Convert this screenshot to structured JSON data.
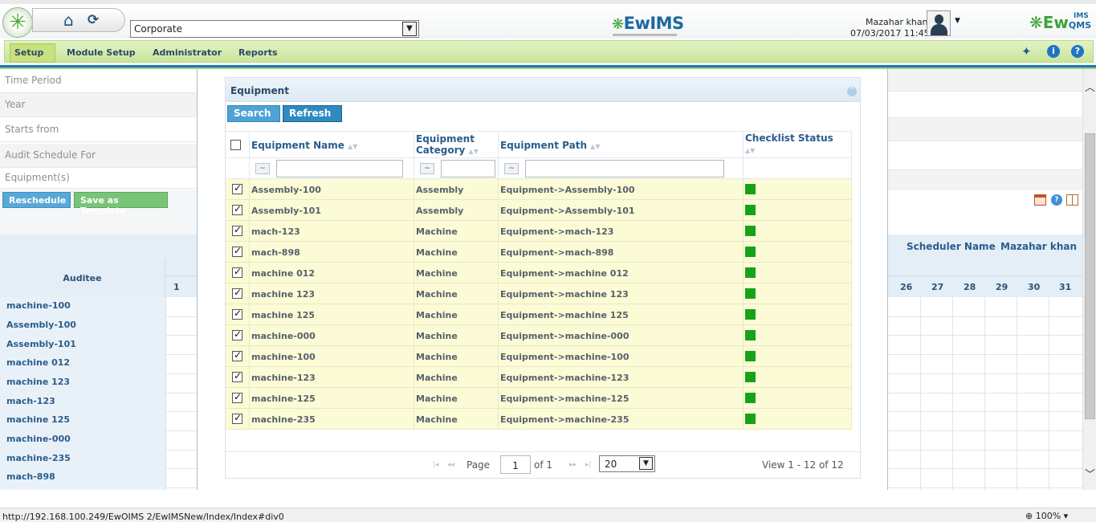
{
  "header": {
    "organization": "Corporate",
    "brand_center": "EwIMS",
    "user_name": "Mazahar khan",
    "user_datetime": "07/03/2017 11:45",
    "brand_right": "Ew",
    "brand_right_sup": "IMS",
    "brand_right_sub": "QMS"
  },
  "menu": {
    "items": [
      "Setup",
      "Module Setup",
      "Administrator",
      "Reports"
    ]
  },
  "form": {
    "rows": [
      "Time Period",
      "Year",
      "Starts from",
      "Audit Schedule For",
      "Equipment(s)"
    ]
  },
  "actions": {
    "reschedule": "Reschedule",
    "save_template": "Save as Template"
  },
  "calendar": {
    "auditee_header": "Auditee",
    "first_day": "1",
    "auditees": [
      "machine-100",
      "Assembly-100",
      "Assembly-101",
      "machine 012",
      "machine 123",
      "mach-123",
      "machine 125",
      "machine-000",
      "machine-235",
      "mach-898"
    ],
    "scheduler_label": "Scheduler Name",
    "scheduler_value": "Mazahar khan",
    "right_days": [
      "26",
      "27",
      "28",
      "29",
      "30",
      "31"
    ]
  },
  "dialog": {
    "title": "Equipment",
    "search_label": "Search",
    "refresh_label": "Refresh",
    "columns": {
      "name": "Equipment Name",
      "category_line1": "Equipment",
      "category_line2": "Category",
      "path": "Equipment Path",
      "checklist_line1": "Checklist Status",
      "checklist_line2": ""
    },
    "filter_icon": "~",
    "rows": [
      {
        "name": "Assembly-100",
        "category": "Assembly",
        "path": "Equipment->Assembly-100",
        "checked": true
      },
      {
        "name": "Assembly-101",
        "category": "Assembly",
        "path": "Equipment->Assembly-101",
        "checked": true
      },
      {
        "name": "mach-123",
        "category": "Machine",
        "path": "Equipment->mach-123",
        "checked": true
      },
      {
        "name": "mach-898",
        "category": "Machine",
        "path": "Equipment->mach-898",
        "checked": true
      },
      {
        "name": "machine 012",
        "category": "Machine",
        "path": "Equipment->machine 012",
        "checked": true
      },
      {
        "name": "machine 123",
        "category": "Machine",
        "path": "Equipment->machine 123",
        "checked": true
      },
      {
        "name": "machine 125",
        "category": "Machine",
        "path": "Equipment->machine 125",
        "checked": true
      },
      {
        "name": "machine-000",
        "category": "Machine",
        "path": "Equipment->machine-000",
        "checked": true
      },
      {
        "name": "machine-100",
        "category": "Machine",
        "path": "Equipment->machine-100",
        "checked": true
      },
      {
        "name": "machine-123",
        "category": "Machine",
        "path": "Equipment->machine-123",
        "checked": true
      },
      {
        "name": "machine-125",
        "category": "Machine",
        "path": "Equipment->machine-125",
        "checked": true
      },
      {
        "name": "machine-235",
        "category": "Machine",
        "path": "Equipment->machine-235",
        "checked": true
      }
    ],
    "status_color": "#17a317",
    "pager": {
      "page_label": "Page",
      "page_value": "1",
      "of_label": "of 1",
      "page_size": "20",
      "view_text": "View 1 - 12 of 12"
    }
  },
  "statusbar": {
    "url": "http://192.168.100.249/EwOIMS 2/EwIMSNew/Index/Index#div0",
    "zoom": "100%"
  }
}
